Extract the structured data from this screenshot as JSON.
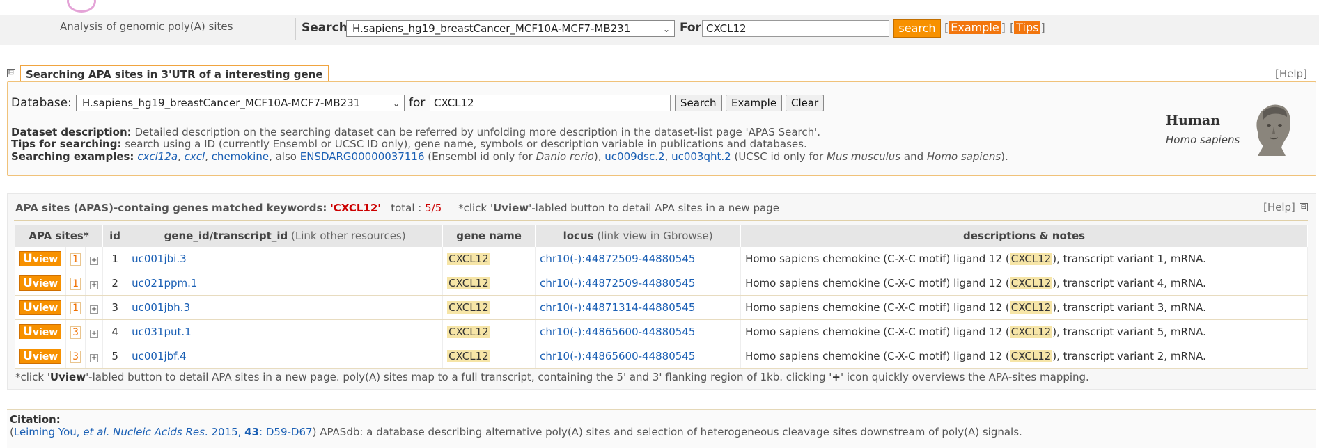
{
  "header": {
    "subtitle": "Analysis of genomic poly(A) sites",
    "search_label": "Search",
    "db_selected": "H.sapiens_hg19_breastCancer_MCF10A-MCF7-MB231",
    "for_label": "For",
    "query": "CXCL12",
    "search_button": "search",
    "example_link": "Example",
    "tips_link": "Tips"
  },
  "search_panel": {
    "legend": "Searching APA sites in 3'UTR of a interesting gene",
    "help": "[Help]",
    "collapse": "⊟",
    "db_label": "Database:",
    "db_selected": "H.sapiens_hg19_breastCancer_MCF10A-MCF7-MB231",
    "for_label": "for",
    "query": "CXCL12",
    "btn_search": "Search",
    "btn_example": "Example",
    "btn_clear": "Clear",
    "desc_label": "Dataset description:",
    "desc_text": " Detailed description on the searching dataset can be referred by unfolding more description in the dataset-list page 'APAS Search'.",
    "tips_label": "Tips for searching:",
    "tips_text": " search using a ID (currently Ensembl or UCSC ID only), gene name, symbols or description variable in publications and databases.",
    "examples_label": "Searching examples:",
    "ex1": "cxcl12a",
    "ex_sep1": ", ",
    "ex2": "cxcl",
    "ex_sep2": ", ",
    "ex3": "chemokine",
    "ex_also": ", also ",
    "ex4": "ENSDARG00000037116",
    "ex_note1": " (Ensembl id only for ",
    "ex_species1": "Danio rerio",
    "ex_note2": "), ",
    "ex5": "uc009dsc.2",
    "ex_sep3": ", ",
    "ex6": "uc003qht.2",
    "ex_note3": " (UCSC id only for ",
    "ex_species2": "Mus musculus",
    "ex_and": " and ",
    "ex_species3": "Homo sapiens",
    "ex_end": ").",
    "species_title": "Human",
    "species_sub": "Homo sapiens"
  },
  "results": {
    "head_label": "APA sites (APAS)-containg genes matched keywords:",
    "keyword": "'CXCL12'",
    "total_label": "total : ",
    "total_value": "5/5",
    "note_pre": "*click '",
    "note_bold": "Uview",
    "note_post": "'-labled button to detail APA sites in a new page",
    "help": "[Help]",
    "collapse": "⊟",
    "columns": {
      "apa": "APA sites*",
      "id": "id",
      "gene_id": "gene_id/transcript_id",
      "gene_id_sub": " (Link other resources)",
      "gene_name": "gene name",
      "locus": "locus",
      "locus_sub": " (link view in Gbrowse)",
      "desc": "descriptions & notes"
    },
    "rows": [
      {
        "u": "U",
        "view": "view",
        "count": "1",
        "plus": "+",
        "id": "1",
        "transcript": "uc001jbi.3",
        "gene": "CXCL12",
        "locus": "chr10(-):44872509-44880545",
        "desc_pre": "Homo sapiens chemokine (C-X-C motif) ligand 12 (",
        "desc_gene": "CXCL12",
        "desc_post": "), transcript variant 1, mRNA."
      },
      {
        "u": "U",
        "view": "view",
        "count": "1",
        "plus": "+",
        "id": "2",
        "transcript": "uc021ppm.1",
        "gene": "CXCL12",
        "locus": "chr10(-):44872509-44880545",
        "desc_pre": "Homo sapiens chemokine (C-X-C motif) ligand 12 (",
        "desc_gene": "CXCL12",
        "desc_post": "), transcript variant 4, mRNA."
      },
      {
        "u": "U",
        "view": "view",
        "count": "1",
        "plus": "+",
        "id": "3",
        "transcript": "uc001jbh.3",
        "gene": "CXCL12",
        "locus": "chr10(-):44871314-44880545",
        "desc_pre": "Homo sapiens chemokine (C-X-C motif) ligand 12 (",
        "desc_gene": "CXCL12",
        "desc_post": "), transcript variant 3, mRNA."
      },
      {
        "u": "U",
        "view": "view",
        "count": "3",
        "plus": "+",
        "id": "4",
        "transcript": "uc031put.1",
        "gene": "CXCL12",
        "locus": "chr10(-):44865600-44880545",
        "desc_pre": "Homo sapiens chemokine (C-X-C motif) ligand 12 (",
        "desc_gene": "CXCL12",
        "desc_post": "), transcript variant 5, mRNA."
      },
      {
        "u": "U",
        "view": "view",
        "count": "3",
        "plus": "+",
        "id": "5",
        "transcript": "uc001jbf.4",
        "gene": "CXCL12",
        "locus": "chr10(-):44865600-44880545",
        "desc_pre": "Homo sapiens chemokine (C-X-C motif) ligand 12 (",
        "desc_gene": "CXCL12",
        "desc_post": "), transcript variant 2, mRNA."
      }
    ],
    "foot_pre": "*click '",
    "foot_bold1": "Uview",
    "foot_mid": "'-labled button to detail APA sites in a new page. poly(A) sites map to a full transcript, containing the 5' and 3' flanking region of 1kb. clicking '",
    "foot_bold2": "+",
    "foot_post": "' icon quickly overviews the APA-sites mapping."
  },
  "citation": {
    "title": "Citation:",
    "open": "(",
    "author": "Leiming You, ",
    "etal": "et al.",
    "journal": " Nucleic Acids Res",
    "year": ". 2015, ",
    "volume": "43",
    "pages": ": D59-D67",
    "close": ")",
    "text": " APASdb: a database describing alternative poly(A) sites and selection of heterogeneous cleavage sites downstream of poly(A) signals."
  }
}
